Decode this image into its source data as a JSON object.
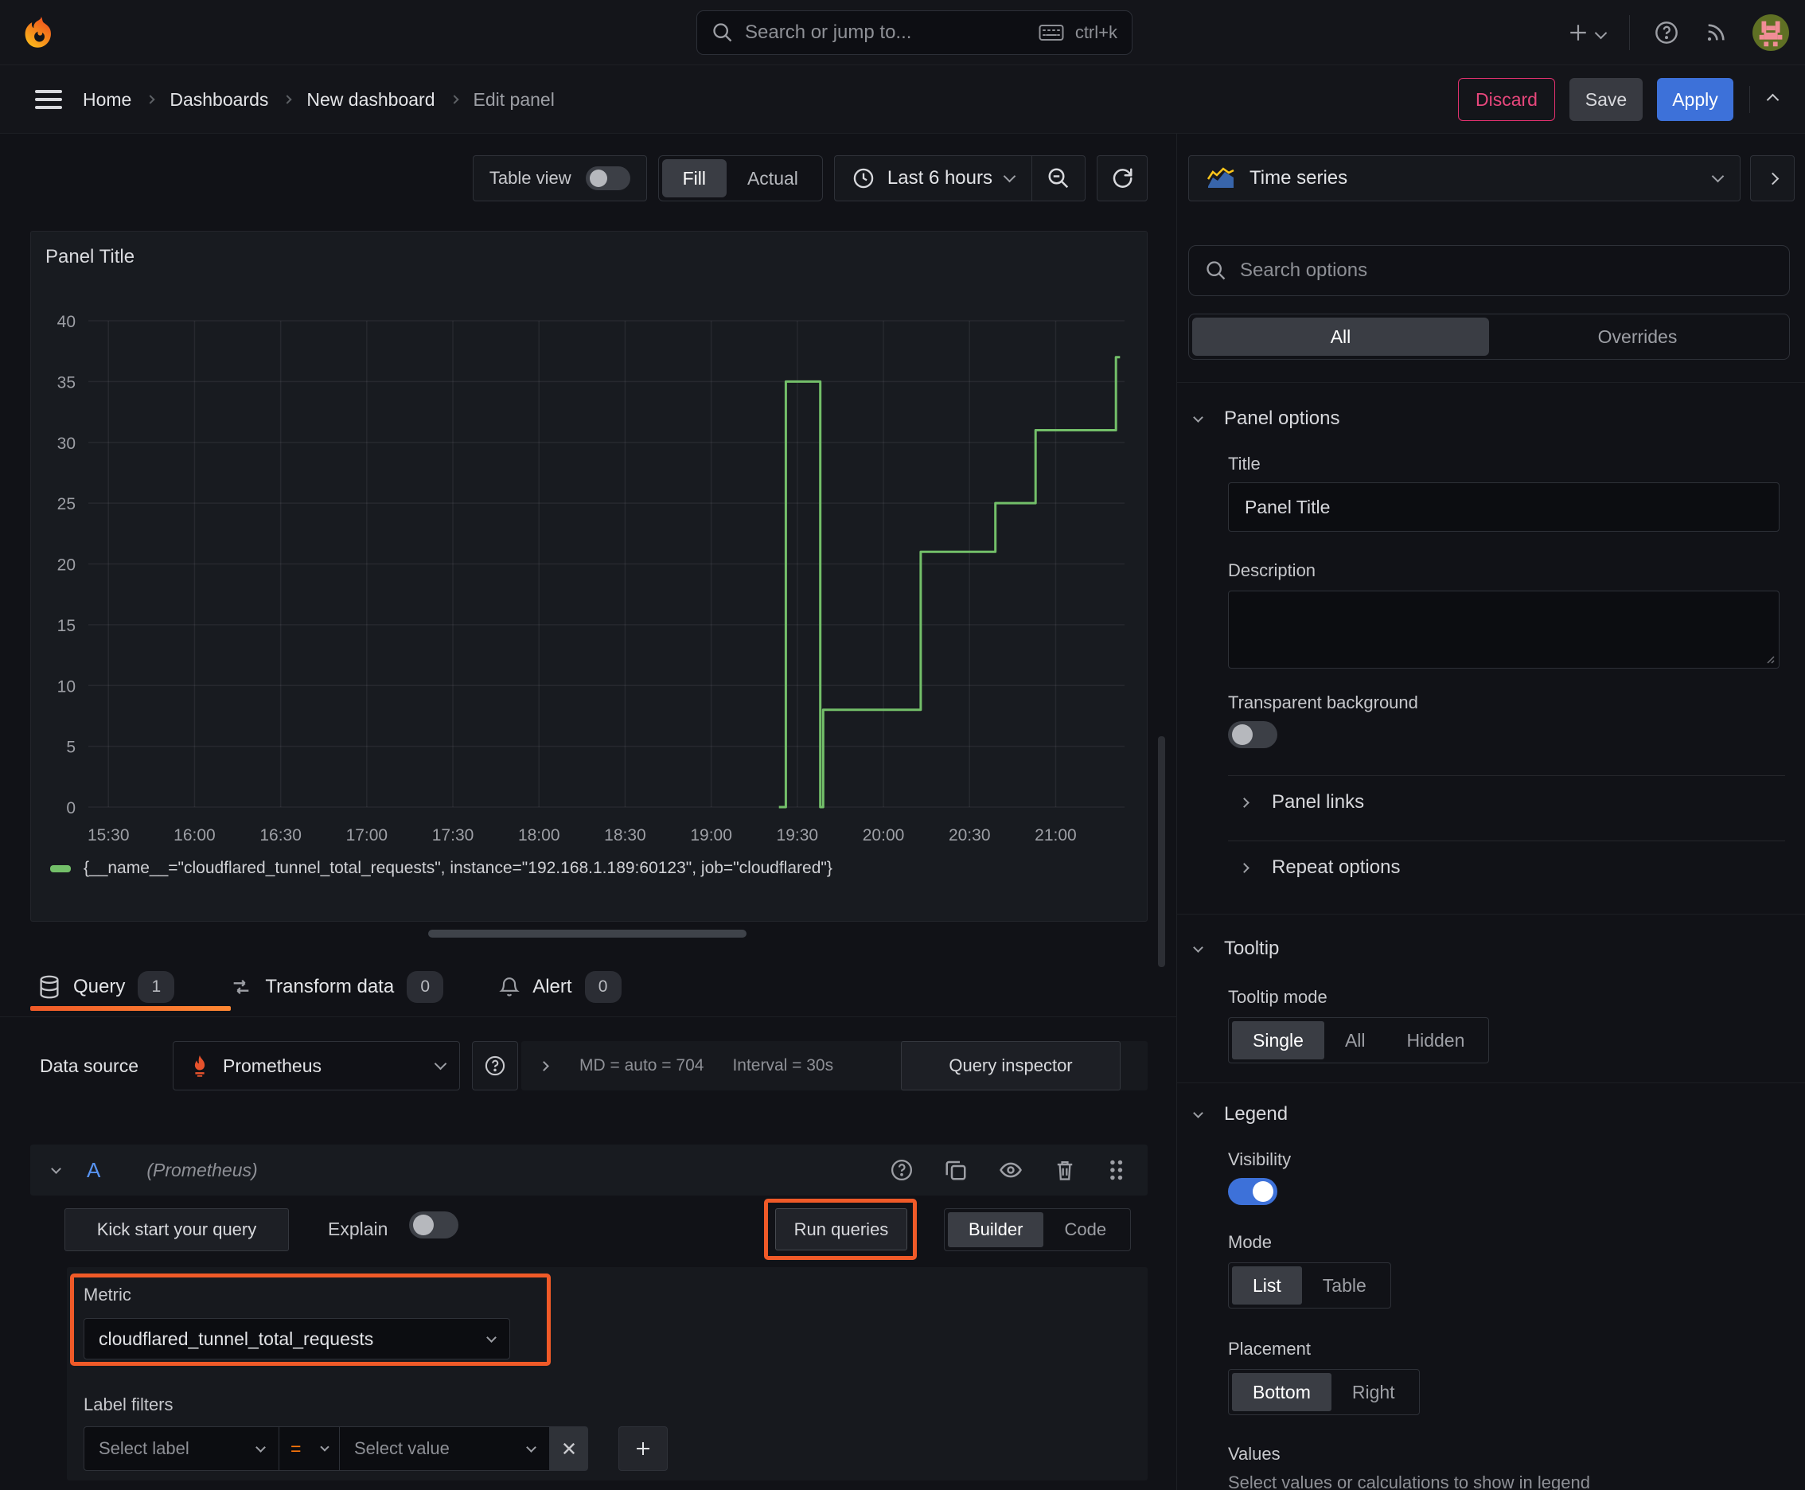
{
  "nav": {
    "search_placeholder": "Search or jump to...",
    "search_shortcut": "ctrl+k"
  },
  "breadcrumb": {
    "items": [
      "Home",
      "Dashboards",
      "New dashboard",
      "Edit panel"
    ],
    "separator": "›"
  },
  "actions": {
    "discard": "Discard",
    "save": "Save",
    "apply": "Apply"
  },
  "toolbar": {
    "table_view": "Table view",
    "fill": "Fill",
    "actual": "Actual",
    "time_range": "Last 6 hours"
  },
  "panel": {
    "title": "Panel Title",
    "legend": "{__name__=\"cloudflared_tunnel_total_requests\", instance=\"192.168.1.189:60123\", job=\"cloudflared\"}"
  },
  "chart_data": {
    "type": "line",
    "title": "Panel Title",
    "xlabel": "",
    "ylabel": "",
    "ylim": [
      0,
      40
    ],
    "yticks": [
      0,
      5,
      10,
      15,
      20,
      25,
      30,
      35,
      40
    ],
    "xticks": [
      "15:30",
      "16:00",
      "16:30",
      "17:00",
      "17:30",
      "18:00",
      "18:30",
      "19:00",
      "19:30",
      "20:00",
      "20:30",
      "21:00"
    ],
    "x_domain_minutes": [
      923,
      1284
    ],
    "grid": true,
    "legend_position": "bottom",
    "series": [
      {
        "name": "{__name__=\"cloudflared_tunnel_total_requests\", instance=\"192.168.1.189:60123\", job=\"cloudflared\"}",
        "color": "#73bf69",
        "points": [
          [
            "19:24",
            0
          ],
          [
            "19:26",
            0
          ],
          [
            "19:26",
            35
          ],
          [
            "19:38",
            35
          ],
          [
            "19:38",
            0
          ],
          [
            "19:39",
            0
          ],
          [
            "19:39",
            8
          ],
          [
            "20:13",
            8
          ],
          [
            "20:13",
            21
          ],
          [
            "20:39",
            21
          ],
          [
            "20:39",
            25
          ],
          [
            "20:53",
            25
          ],
          [
            "20:53",
            31
          ],
          [
            "21:21",
            31
          ],
          [
            "21:21",
            37
          ],
          [
            "21:22",
            37
          ]
        ]
      }
    ]
  },
  "tabs": {
    "query": {
      "label": "Query",
      "count": "1"
    },
    "transform": {
      "label": "Transform data",
      "count": "0"
    },
    "alert": {
      "label": "Alert",
      "count": "0"
    }
  },
  "query": {
    "datasource_label": "Data source",
    "datasource": "Prometheus",
    "stats_md": "MD = auto = 704",
    "stats_interval": "Interval = 30s",
    "inspector": "Query inspector",
    "ref": "A",
    "ref_ds": "(Prometheus)",
    "kickstart": "Kick start your query",
    "explain": "Explain",
    "run": "Run queries",
    "builder": "Builder",
    "code": "Code",
    "metric_label": "Metric",
    "metric_value": "cloudflared_tunnel_total_requests",
    "label_filters": "Label filters",
    "select_label": "Select label",
    "operator": "=",
    "select_value": "Select value"
  },
  "options": {
    "viz": "Time series",
    "search_placeholder": "Search options",
    "tab_all": "All",
    "tab_overrides": "Overrides",
    "panel_options_title": "Panel options",
    "title_label": "Title",
    "title_value": "Panel Title",
    "description_label": "Description",
    "transparent_label": "Transparent background",
    "panel_links": "Panel links",
    "repeat_options": "Repeat options",
    "tooltip_title": "Tooltip",
    "tooltip_mode_label": "Tooltip mode",
    "tooltip_modes": [
      "Single",
      "All",
      "Hidden"
    ],
    "legend_title": "Legend",
    "visibility_label": "Visibility",
    "mode_label": "Mode",
    "legend_modes": [
      "List",
      "Table"
    ],
    "placement_label": "Placement",
    "placements": [
      "Bottom",
      "Right"
    ],
    "values_label": "Values",
    "values_hint": "Select values or calculations to show in legend"
  },
  "colors": {
    "accent_blue": "#3d71d9",
    "series_green": "#73bf69",
    "annotation_orange": "#f05a28",
    "discard_pink": "#e0316e"
  }
}
